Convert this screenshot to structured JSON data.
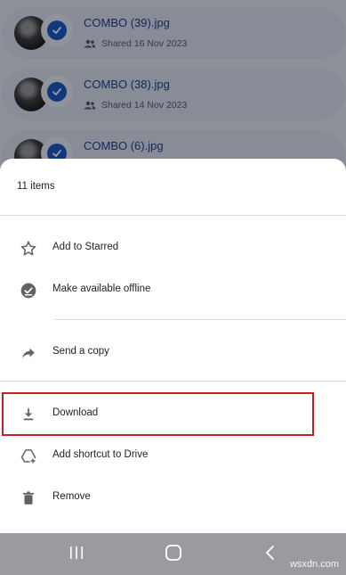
{
  "background_files": [
    {
      "name": "COMBO (39).jpg",
      "shared": "Shared 16 Nov 2023"
    },
    {
      "name": "COMBO (38).jpg",
      "shared": "Shared 14 Nov 2023"
    },
    {
      "name": "COMBO (6).jpg",
      "shared": ""
    }
  ],
  "sheet": {
    "count": "11 items",
    "items": [
      {
        "label": "Add to Starred",
        "icon": "star-outline-icon"
      },
      {
        "label": "Make available offline",
        "icon": "offline-pin-icon"
      },
      {
        "label": "Send a copy",
        "icon": "share-arrow-icon"
      },
      {
        "label": "Download",
        "icon": "download-icon"
      },
      {
        "label": "Add shortcut to Drive",
        "icon": "add-shortcut-icon"
      },
      {
        "label": "Remove",
        "icon": "trash-icon"
      }
    ]
  },
  "watermark": "wsxdn.com",
  "colors": {
    "highlight": "#c42026",
    "check": "#1a56c9",
    "sheet": "#ffffff"
  }
}
